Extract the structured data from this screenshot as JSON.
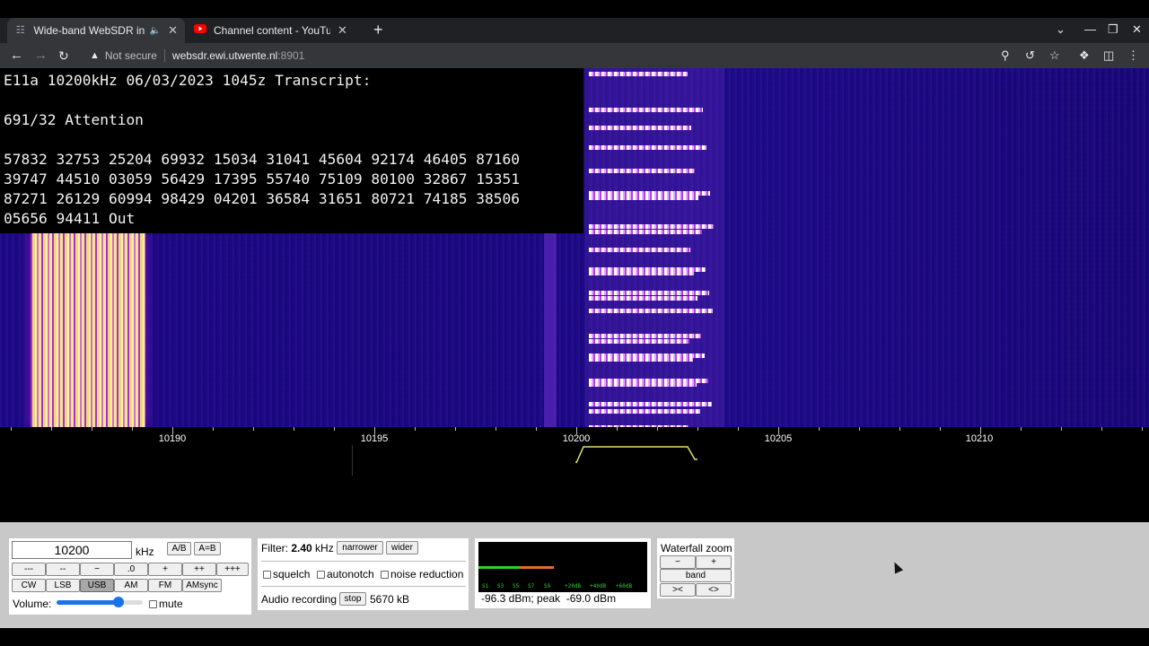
{
  "browser": {
    "tabs": [
      {
        "title": "Wide-band WebSDR in Ensch",
        "favicon": "websdr-favicon",
        "audio": true,
        "active": true
      },
      {
        "title": "Channel content - YouTube Studi",
        "favicon": "youtube-favicon",
        "audio": false,
        "active": false
      }
    ],
    "address": {
      "security": "Not secure",
      "host": "websdr.ewi.utwente.nl",
      "port": ":8901"
    }
  },
  "transcript": {
    "line1": "E11a 10200kHz 06/03/2023 1045z Transcript:",
    "line2": "691/32 Attention",
    "line3": "57832 32753 25204 69932 15034 31041 45604 92174 46405 87160",
    "line4": "39747 44510 03059 56429 17395 55740 75109 80100 32867 15351",
    "line5": "87271 26129 60994 98429 04201 36584 31651 80721 74185 38506",
    "line6": "05656 94411 Out"
  },
  "scale": {
    "labels": [
      "10190",
      "10195",
      "10200",
      "10205",
      "10210"
    ]
  },
  "controls": {
    "frequency": {
      "value": "10200",
      "unit": "kHz",
      "ab_label": "A/B",
      "aeqb_label": "A=B",
      "step_buttons": [
        "---",
        "--",
        "−",
        ".0",
        "+",
        "++",
        "+++"
      ],
      "modes": [
        "CW",
        "LSB",
        "USB",
        "AM",
        "FM",
        "AMsync"
      ],
      "active_mode": "USB",
      "volume_label": "Volume:",
      "volume_level": 0.72,
      "mute_label": "mute"
    },
    "filter": {
      "label": "Filter:",
      "value": "2.40",
      "unit": "kHz",
      "narrower": "narrower",
      "wider": "wider",
      "squelch": "squelch",
      "autonotch": "autonotch",
      "noise_reduction": "noise reduction",
      "recording_label": "Audio recording",
      "stop": "stop",
      "size": "5670 kB"
    },
    "smeter": {
      "scale_labels": [
        "S1",
        "S3",
        "S5",
        "S7",
        "S9",
        "+20dB",
        "+40dB",
        "+60dB"
      ],
      "reading": "-96.3 dBm; peak  -69.0 dBm",
      "colors": {
        "level": "#30d030",
        "peak": "#e07030"
      }
    },
    "zoom": {
      "title": "Waterfall zoom",
      "minus": "−",
      "plus": "+",
      "band": "band",
      "shrink": "><",
      "expand": "<>"
    }
  }
}
